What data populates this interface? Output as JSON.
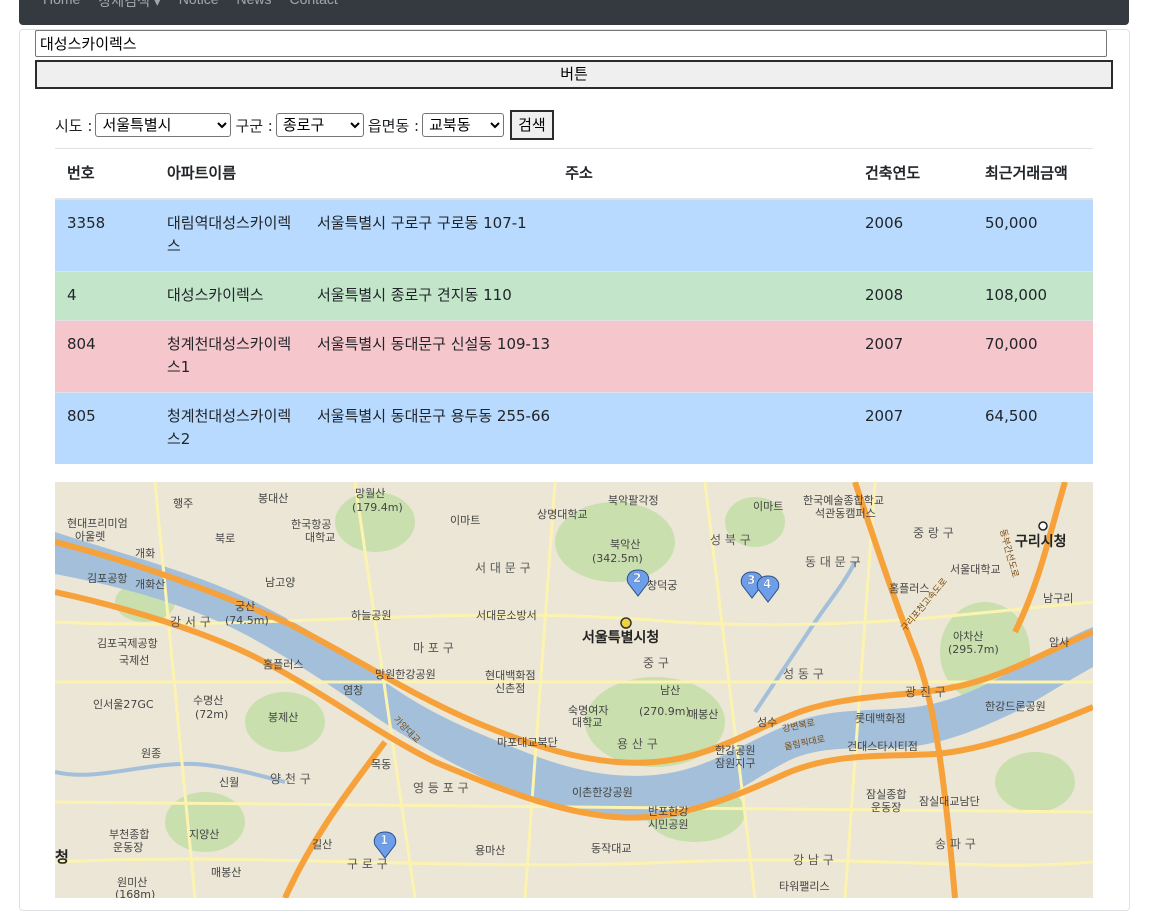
{
  "navbar": {
    "links": [
      "Home",
      "상세검색 ▾",
      "Notice",
      "News",
      "Contact"
    ]
  },
  "search": {
    "value": "대성스카이렉스",
    "button_label": "버튼"
  },
  "filters": {
    "sido_label": "시도 :",
    "sido_value": "서울특별시",
    "gugun_label": "구군 :",
    "gugun_value": "종로구",
    "dong_label": "읍면동 :",
    "dong_value": "교북동",
    "search_label": "검색"
  },
  "table": {
    "headers": [
      "번호",
      "아파트이름",
      "주소",
      "건축연도",
      "최근거래금액"
    ],
    "rows": [
      {
        "no": "3358",
        "name": "대림역대성스카이렉스",
        "address": "서울특별시 구로구 구로동 107-1",
        "year": "2006",
        "price": "50,000",
        "color": "blue"
      },
      {
        "no": "4",
        "name": "대성스카이렉스",
        "address": "서울특별시 종로구 견지동 110",
        "year": "2008",
        "price": "108,000",
        "color": "green"
      },
      {
        "no": "804",
        "name": "청계천대성스카이렉스1",
        "address": "서울특별시 동대문구 신설동 109-13",
        "year": "2007",
        "price": "70,000",
        "color": "red"
      },
      {
        "no": "805",
        "name": "청계천대성스카이렉스2",
        "address": "서울특별시 동대문구 용두동 255-66",
        "year": "2007",
        "price": "64,500",
        "color": "blue"
      }
    ]
  },
  "map": {
    "labels": {
      "seoul_hall": "서울특별시청",
      "seodaemun": "서 대 문 구",
      "seongbuk": "성 북 구",
      "dongdaemun": "동 대 문 구",
      "jungnang": "중 랑 구",
      "guri": "구리시청",
      "mapo": "마 포 구",
      "jung": "중 구",
      "yongsan": "용 산 구",
      "seongdong": "성 동 구",
      "gwangjin": "광 진 구",
      "gangseo": "강 서 구",
      "yangcheon": "양 천 구",
      "yeongdeungpo": "영 등 포 구",
      "guro": "구 로 구",
      "gangnam": "강 남 구",
      "songpa": "송 파 구",
      "namsan": "남산",
      "namsan_h": "(270.9m)",
      "bugaksan": "북악산",
      "bugaksan_h": "(342.5m)",
      "achasan": "아차산",
      "achasan_h": "(295.7m)",
      "mangwolsan": "망월산",
      "mangwolsan_h": "(179.4m)",
      "gunsan": "궁산",
      "gunsan_h": "(74.5m)",
      "sumyeongsan": "수명산",
      "sumyeongsan_h": "(72m)",
      "gimpo_airport": "김포국제공항",
      "gimpo_intl": "국제선",
      "lotte": "롯데백화점",
      "lotte2": "건대스타시티점",
      "hyundai": "현대백화점",
      "hyundai2": "신촌점",
      "sookmyung": "숙명여자",
      "sookmyung2": "대학교",
      "emart1": "이마트",
      "emart2": "이마트",
      "homeplus1": "홈플러스",
      "homeplus2": "홈플러스",
      "mangwon": "망원한강공원",
      "haneul": "하늘공원",
      "ichon": "이촌한강공원",
      "banpo": "반포한강",
      "banpo2": "시민공원",
      "jamsil": "잠실종합",
      "jamsil2": "운동장",
      "jamsil_bridge": "잠실대교남단",
      "mapo_bridge": "마포대교북단",
      "hangang_park": "한강공원",
      "hangang_park2": "잠원지구",
      "timessquare": "타워팰리스",
      "bucheon": "부천종합",
      "bucheon2": "운동장",
      "gaehwa": "개화",
      "gaehwasan": "개화산",
      "gimpo_gonghang": "김포공항",
      "bongjesan": "봉제산",
      "mokdong": "목동",
      "yeomchang": "염창",
      "wonjong": "원종",
      "sinwol": "신월",
      "jiyangsan": "지양산",
      "gildong": "길산",
      "yongmasan": "용마산",
      "dongjak": "동작대교",
      "hansung": "한국예술종합학교",
      "hansung2": "석관동캠퍼스",
      "sangmyung": "상명대학교",
      "seoul_national": "서울대학교",
      "seodaemun_prison": "서대문소방서",
      "changdeok": "창덕궁",
      "bugak_gate": "북악팔각정",
      "hangyeong": "한국항공",
      "hangyeong2": "대학교",
      "namgoyang": "남고양",
      "bukro": "북로",
      "haengju": "행주",
      "bongdaesan": "봉대산",
      "incheon27": "인서울27GC",
      "hyundai_mall": "현대프리미엄",
      "hyundai_mall2": "아울렛",
      "maebongsan": "매봉산",
      "wonmisan": "원미산",
      "wonmisan_h": "(168m)",
      "seongsu": "성수",
      "maebong": "매봉산",
      "hangang_guri": "한강드론공원",
      "namguri": "남구리",
      "amsa": "암사",
      "guri_hwy": "구리포천고속도로",
      "gangbyeon": "강변북로",
      "olympic": "올림픽대로",
      "dongbu": "동부간선도로",
      "sinnae_bridge": "가양대교",
      "cheong": "청"
    },
    "markers": [
      "1",
      "2",
      "3",
      "4"
    ],
    "colors": {
      "water": "#a3bfd9",
      "highway": "#f7a13b",
      "road": "#fdf2a8",
      "park": "#c8dfb0",
      "marker": "#6f9ee8"
    }
  }
}
